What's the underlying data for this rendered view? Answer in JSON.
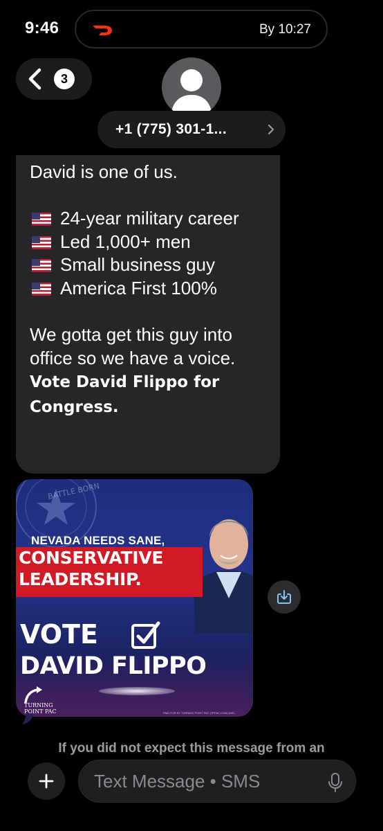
{
  "status_bar": {
    "time": "9:46",
    "live_activity_eta": "By 10:27",
    "live_activity_app_icon": "doordash-icon"
  },
  "header": {
    "back_badge_count": "3",
    "contact_name": "+1 (775) 301-1...",
    "avatar_icon": "person-icon"
  },
  "message": {
    "line1": "David is one of us.",
    "bullets": [
      "24-year military career",
      "Led 1,000+ men",
      "Small business guy",
      "America First 100%"
    ],
    "bullet_icon": "us-flag-emoji",
    "closing": "We gotta get this guy into office so we have a voice.",
    "closing_bold": "Vote David Flippo for Congress."
  },
  "image": {
    "seal_text": "BATTLE BORN",
    "headline_small": "NEVADA NEEDS SANE,",
    "headline_line1": "CONSERVATIVE",
    "headline_line2": "LEADERSHIP.",
    "vote": "VOTE",
    "candidate": "DAVID FLIPPO",
    "brand_line1": "TURNING",
    "brand_line2": "POINT PAC",
    "paid_by": "PAID FOR BY TURNING POINT PAC (TPPAC.COM) AND..."
  },
  "notice": "If you did not expect this message from an",
  "composer": {
    "placeholder": "Text Message • SMS"
  },
  "colors": {
    "background": "#000000",
    "bubble": "#262628",
    "pill": "#1c1c1e",
    "ad_red": "#d11a26",
    "ad_blue": "#25338c",
    "download_accent": "#7fc3ff"
  }
}
